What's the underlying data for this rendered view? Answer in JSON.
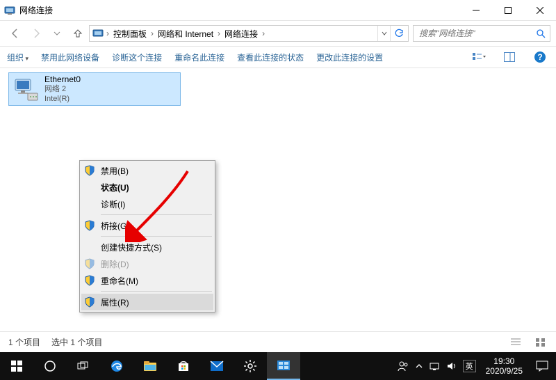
{
  "window": {
    "title": "网络连接"
  },
  "breadcrumb": {
    "root_icon": "network-panel-icon",
    "items": [
      "控制面板",
      "网络和 Internet",
      "网络连接"
    ]
  },
  "search": {
    "placeholder": "搜索\"网络连接\""
  },
  "cmdbar": {
    "organize": "组织",
    "disable": "禁用此网络设备",
    "diagnose": "诊断这个连接",
    "rename": "重命名此连接",
    "view_status": "查看此连接的状态",
    "change_settings": "更改此连接的设置"
  },
  "item": {
    "name": "Ethernet0",
    "status": "网络 2",
    "device": "Intel(R)"
  },
  "ctxmenu": {
    "disable": "禁用(B)",
    "status": "状态(U)",
    "diagnose": "诊断(I)",
    "bridge": "桥接(G)",
    "shortcut": "创建快捷方式(S)",
    "delete": "删除(D)",
    "rename": "重命名(M)",
    "properties": "属性(R)"
  },
  "statusbar": {
    "count": "1 个项目",
    "selected": "选中 1 个项目"
  },
  "taskbar": {
    "ime": "英",
    "time": "19:30",
    "date": "2020/9/25"
  }
}
